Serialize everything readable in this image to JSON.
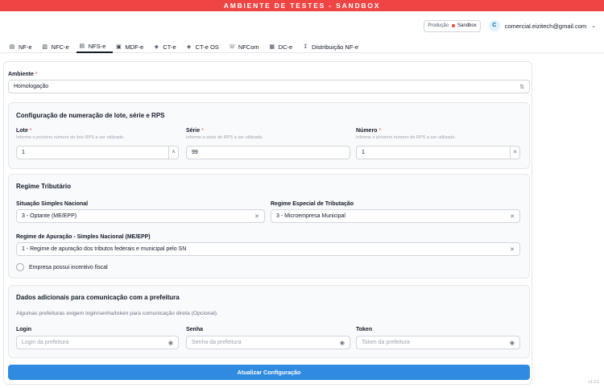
{
  "banner": "AMBIENTE DE TESTES - SANDBOX",
  "env_toggle": {
    "producao": "Produção",
    "sandbox": "Sandbox"
  },
  "user": {
    "initial": "C",
    "email": "comercial.eizitech@gmail.com"
  },
  "tabs": [
    {
      "label": "NF-e",
      "icon": "document-icon"
    },
    {
      "label": "NFC-e",
      "icon": "receipt-icon"
    },
    {
      "label": "NFS-e",
      "icon": "file-text-icon",
      "active": true
    },
    {
      "label": "MDF-e",
      "icon": "truck-icon"
    },
    {
      "label": "CT-e",
      "icon": "package-icon"
    },
    {
      "label": "CT-e OS",
      "icon": "package-icon"
    },
    {
      "label": "NFCom",
      "icon": "phone-icon"
    },
    {
      "label": "DC-e",
      "icon": "boxes-icon"
    },
    {
      "label": "Distribuição NF-e",
      "icon": "download-icon"
    }
  ],
  "ambiente": {
    "label": "Ambiente",
    "value": "Homologação"
  },
  "numeracao": {
    "title": "Configuração de numeração de lote, série e RPS",
    "lote": {
      "label": "Lote",
      "hint": "Informe o próximo número do lote RPS a ser utilizado.",
      "value": "1"
    },
    "serie": {
      "label": "Série",
      "hint": "Informe a série de RPS a ser utilizada.",
      "value": "99"
    },
    "numero": {
      "label": "Número",
      "hint": "Informe o próximo número de RPS a ser utilizado.",
      "value": "1"
    }
  },
  "regime": {
    "title": "Regime Tributário",
    "simples": {
      "label": "Situação Simples Nacional",
      "value": "3 - Optante (ME/EPP)"
    },
    "especial": {
      "label": "Regime Especial de Tributação",
      "value": "3 - Microempresa Municipal"
    },
    "apuracao": {
      "label": "Regime de Apuração - Simples Nacional (ME/EPP)",
      "value": "1 - Regime de apuração dos tributos federais e municipal pelo SN"
    },
    "incentivo": "Empresa possui incentivo fiscal"
  },
  "adicionais": {
    "title": "Dados adicionais para comunicação com a prefeitura",
    "subtitle": "Algumas prefeituras exigem login/senha/token para comunicação direta (Opcional).",
    "login": {
      "label": "Login",
      "placeholder": "Login da prefeitura"
    },
    "senha": {
      "label": "Senha",
      "placeholder": "Senha da prefeitura"
    },
    "token": {
      "label": "Token",
      "placeholder": "Token da prefeitura"
    }
  },
  "submit": "Atualizar Configuração",
  "version": "v1.0.1",
  "colors": {
    "banner": "#ef4444",
    "primary": "#2f8ae0"
  }
}
